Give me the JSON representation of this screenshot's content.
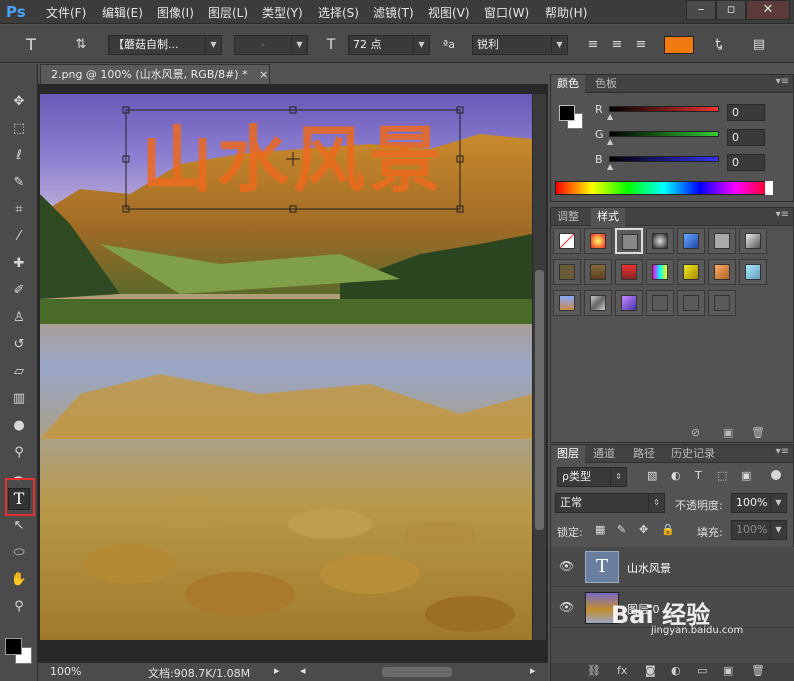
{
  "app": {
    "logo": "Ps"
  },
  "menu": [
    "文件(F)",
    "编辑(E)",
    "图像(I)",
    "图层(L)",
    "类型(Y)",
    "选择(S)",
    "滤镜(T)",
    "视图(V)",
    "窗口(W)",
    "帮助(H)"
  ],
  "options": {
    "font_family": "【蘑菇自制...",
    "font_style": "-",
    "font_size": "72 点",
    "antialias_label": "ªa",
    "antialias": "锐利",
    "text_color": "#f07a10"
  },
  "document": {
    "tab_title": "2.png @ 100% (山水风景, RGB/8#) *",
    "close": "×",
    "overlay_text": "山水风景",
    "overlay_color": "#ec6a1e"
  },
  "status": {
    "zoom": "100%",
    "doc_info": "文档:908.7K/1.08M"
  },
  "color_panel": {
    "tabs": [
      "颜色",
      "色板"
    ],
    "channels": [
      {
        "label": "R",
        "value": "0",
        "color": "#e33"
      },
      {
        "label": "G",
        "value": "0",
        "color": "#3c3"
      },
      {
        "label": "B",
        "value": "0",
        "color": "#33e"
      }
    ]
  },
  "styles_panel": {
    "tabs": [
      "调整",
      "样式"
    ]
  },
  "layers_panel": {
    "tabs": [
      "图层",
      "通道",
      "路径",
      "历史记录"
    ],
    "filter_label": "ρ类型",
    "blend_mode": "正常",
    "opacity_label": "不透明度:",
    "opacity": "100%",
    "lock_label": "锁定:",
    "fill_label": "填充:",
    "fill": "100%",
    "layers": [
      {
        "name": "山水风景",
        "type": "text",
        "selected": true,
        "thumb": "T"
      },
      {
        "name": "图层 0",
        "type": "image",
        "selected": false
      }
    ]
  },
  "watermark": {
    "text": "Bai 经验",
    "sub": "jingyan.baidu.com"
  }
}
